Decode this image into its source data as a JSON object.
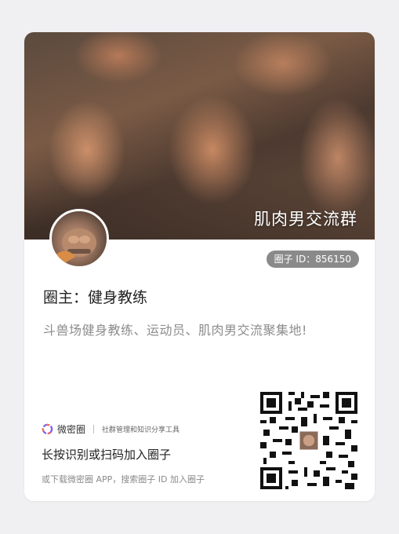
{
  "cover": {
    "title": "肌肉男交流群"
  },
  "group": {
    "id_label": "圈子 ID：856150",
    "owner": "圈主：健身教练",
    "description": "斗兽场健身教练、运动员、肌肉男交流聚集地!"
  },
  "brand": {
    "name": "微密圈",
    "tagline": "社群管理和知识分享工具",
    "logo_icon": "weimiquan-logo-icon"
  },
  "scan": {
    "prompt": "长按识别或扫码加入圈子",
    "download_hint": "或下载微密圈 APP，搜索圈子 ID 加入圈子"
  },
  "colors": {
    "badge_bg": "#8a8a8a",
    "description": "#8d8d8d",
    "background": "#f0f0f2"
  }
}
